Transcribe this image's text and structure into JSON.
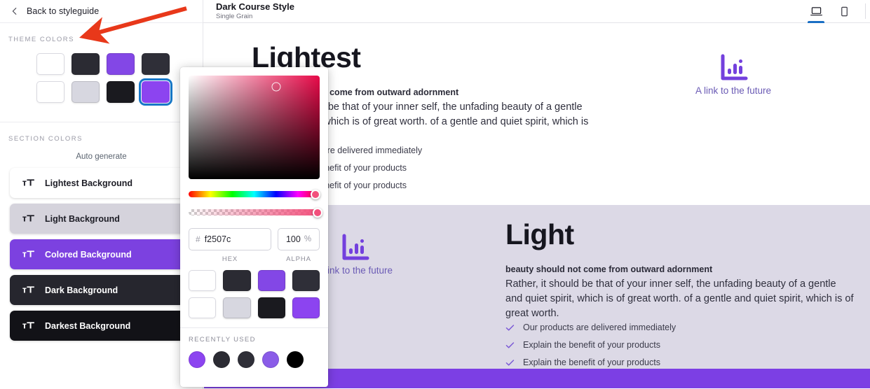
{
  "back_nav": {
    "label": "Back to styleguide",
    "icon": "arrow-left-icon"
  },
  "left_panel": {
    "theme_colors_heading": "THEME COLORS",
    "theme_swatches": [
      {
        "name": "swatch-1",
        "color": "#ffffff",
        "selected": false
      },
      {
        "name": "swatch-2",
        "color": "#2b2b33",
        "selected": false
      },
      {
        "name": "swatch-3",
        "color": "#8347e6",
        "selected": false
      },
      {
        "name": "swatch-4",
        "color": "#2f2f38",
        "selected": false
      },
      {
        "name": "swatch-5",
        "color": "#ffffff",
        "selected": false
      },
      {
        "name": "swatch-6",
        "color": "#d7d7e0",
        "selected": false
      },
      {
        "name": "swatch-7",
        "color": "#1a1a1f",
        "selected": false
      },
      {
        "name": "swatch-8",
        "color": "#8c44f0",
        "selected": true
      }
    ],
    "section_colors_heading": "SECTION COLORS",
    "auto_generate_label": "Auto generate",
    "section_items": [
      {
        "label": "Lightest Background",
        "bg": "#ffffff",
        "fg": "#1d1d26"
      },
      {
        "label": "Light Background",
        "bg": "#d5d3dc",
        "fg": "#1d1d26"
      },
      {
        "label": "Colored Background",
        "bg": "#7c41e0",
        "fg": "#ffffff"
      },
      {
        "label": "Dark Background",
        "bg": "#26262e",
        "fg": "#ffffff"
      },
      {
        "label": "Darkest Background",
        "bg": "#121217",
        "fg": "#ffffff"
      }
    ]
  },
  "header": {
    "title": "Dark Course Style",
    "subtitle": "Single Grain",
    "devices": [
      {
        "name": "desktop",
        "icon": "desktop-icon",
        "active": true
      },
      {
        "name": "mobile",
        "icon": "mobile-icon",
        "active": false
      }
    ]
  },
  "canvas": {
    "sections": [
      {
        "id": "lightest",
        "heading": "Lightest",
        "background": "#ffffff",
        "lead": "beauty should not come from outward adornment",
        "body": "Rather, it should be that of your inner self, the unfading beauty of a gentle and quiet spirit, which is of great worth. of a gentle and quiet spirit, which is of great worth.",
        "checks": [
          "Our products are delivered immediately",
          "Explain the benefit of your products",
          "Explain the benefit of your products"
        ],
        "link": {
          "text": "A link to the future",
          "icon": "bar-chart-icon",
          "color": "#7340dd"
        }
      },
      {
        "id": "light",
        "heading": "Light",
        "background": "#dcd9e6",
        "lead": "beauty should not come from outward adornment",
        "body": "Rather, it should be that of your inner self, the unfading beauty of a gentle and quiet spirit, which is of great worth. of a gentle and quiet spirit, which is of great worth.",
        "checks": [
          "Our products are delivered immediately",
          "Explain the benefit of your products",
          "Explain the benefit of your products"
        ],
        "link": {
          "text": "A link to the future",
          "icon": "bar-chart-icon",
          "color": "#7340dd"
        }
      }
    ],
    "bottom_strip_color": "#7c3fe4"
  },
  "color_picker": {
    "hex_prefix": "#",
    "hex_value": "f2507c",
    "hex_label": "HEX",
    "alpha_value": "100",
    "alpha_suffix": "%",
    "alpha_label": "ALPHA",
    "palette": [
      {
        "name": "palette-1",
        "color": "#ffffff"
      },
      {
        "name": "palette-2",
        "color": "#2b2b33"
      },
      {
        "name": "palette-3",
        "color": "#8347e6"
      },
      {
        "name": "palette-4",
        "color": "#2f2f38"
      },
      {
        "name": "palette-5",
        "color": "#ffffff"
      },
      {
        "name": "palette-6",
        "color": "#d7d7e0"
      },
      {
        "name": "palette-7",
        "color": "#1a1a1f"
      },
      {
        "name": "palette-8",
        "color": "#8c44f0"
      }
    ],
    "recently_used_label": "RECENTLY USED",
    "recently_used": [
      "#8c44f0",
      "#2b2b33",
      "#2f2f38",
      "#8a5ce8",
      "#000000"
    ]
  },
  "annotation": {
    "arrow_color": "#e8381a"
  }
}
